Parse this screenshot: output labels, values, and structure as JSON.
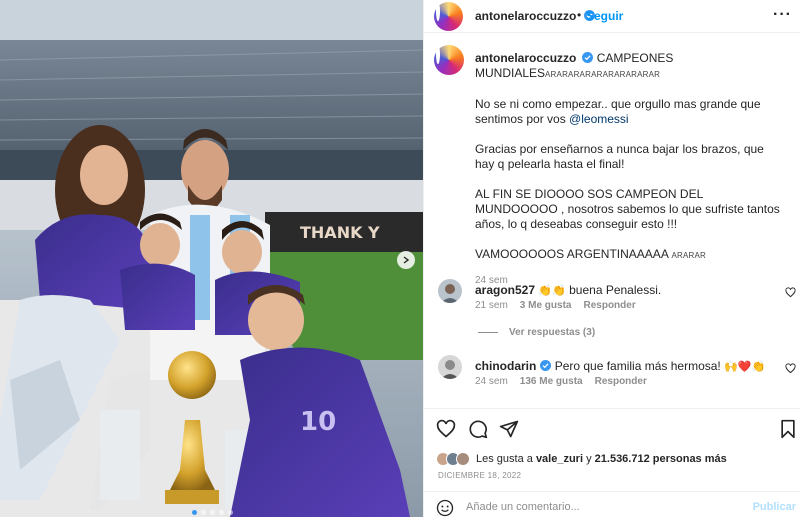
{
  "post": {
    "username": "antonelaroccuzzo",
    "follow_label": "Seguir",
    "dot": "•",
    "more_label": "···",
    "caption": {
      "title": "CAMPEONES MUNDIALES",
      "title_suffix": "ARARARARARARARARARAR",
      "p1_text": "No se ni como empezar.. que orgullo mas grande que sentimos por vos",
      "p1_mention": "@leomessi",
      "p2": "Gracias por enseñarnos a nunca bajar los brazos, que hay q pelearla hasta el final!",
      "p3": "AL FIN SE DIOOOO SOS CAMPEON DEL MUNDOOOOO , nosotros sabemos lo que sufriste tantos años, lo q deseabas conseguir esto !!!",
      "p4": "VAMOOOOOOS ARGENTINAAAAA",
      "p4_suffix": "ARARAR",
      "time": "24 sem"
    },
    "photo_banner_text": "THANK Y"
  },
  "comments": [
    {
      "username": "aragon527",
      "verified": false,
      "text": "buena Penalessi.",
      "emoji": "👏👏",
      "time": "21 sem",
      "likes": "3 Me gusta",
      "reply": "Responder",
      "view_replies": "Ver respuestas (3)"
    },
    {
      "username": "chinodarin",
      "verified": true,
      "text": "Pero que familia más hermosa!",
      "emoji": "🙌❤️👏",
      "time": "24 sem",
      "likes": "136 Me gusta",
      "reply": "Responder"
    }
  ],
  "actions": {
    "likes_prefix": "Les gusta a",
    "likes_user": "vale_zuri",
    "likes_and": "y",
    "likes_count": "21.536.712 personas más",
    "date": "DICIEMBRE 18, 2022"
  },
  "comment_box": {
    "placeholder": "Añade un comentario...",
    "publish_label": "Publicar"
  },
  "colors": {
    "accent": "#0095f6",
    "verified": "#3897f0",
    "heart_red": "#ed4956"
  }
}
